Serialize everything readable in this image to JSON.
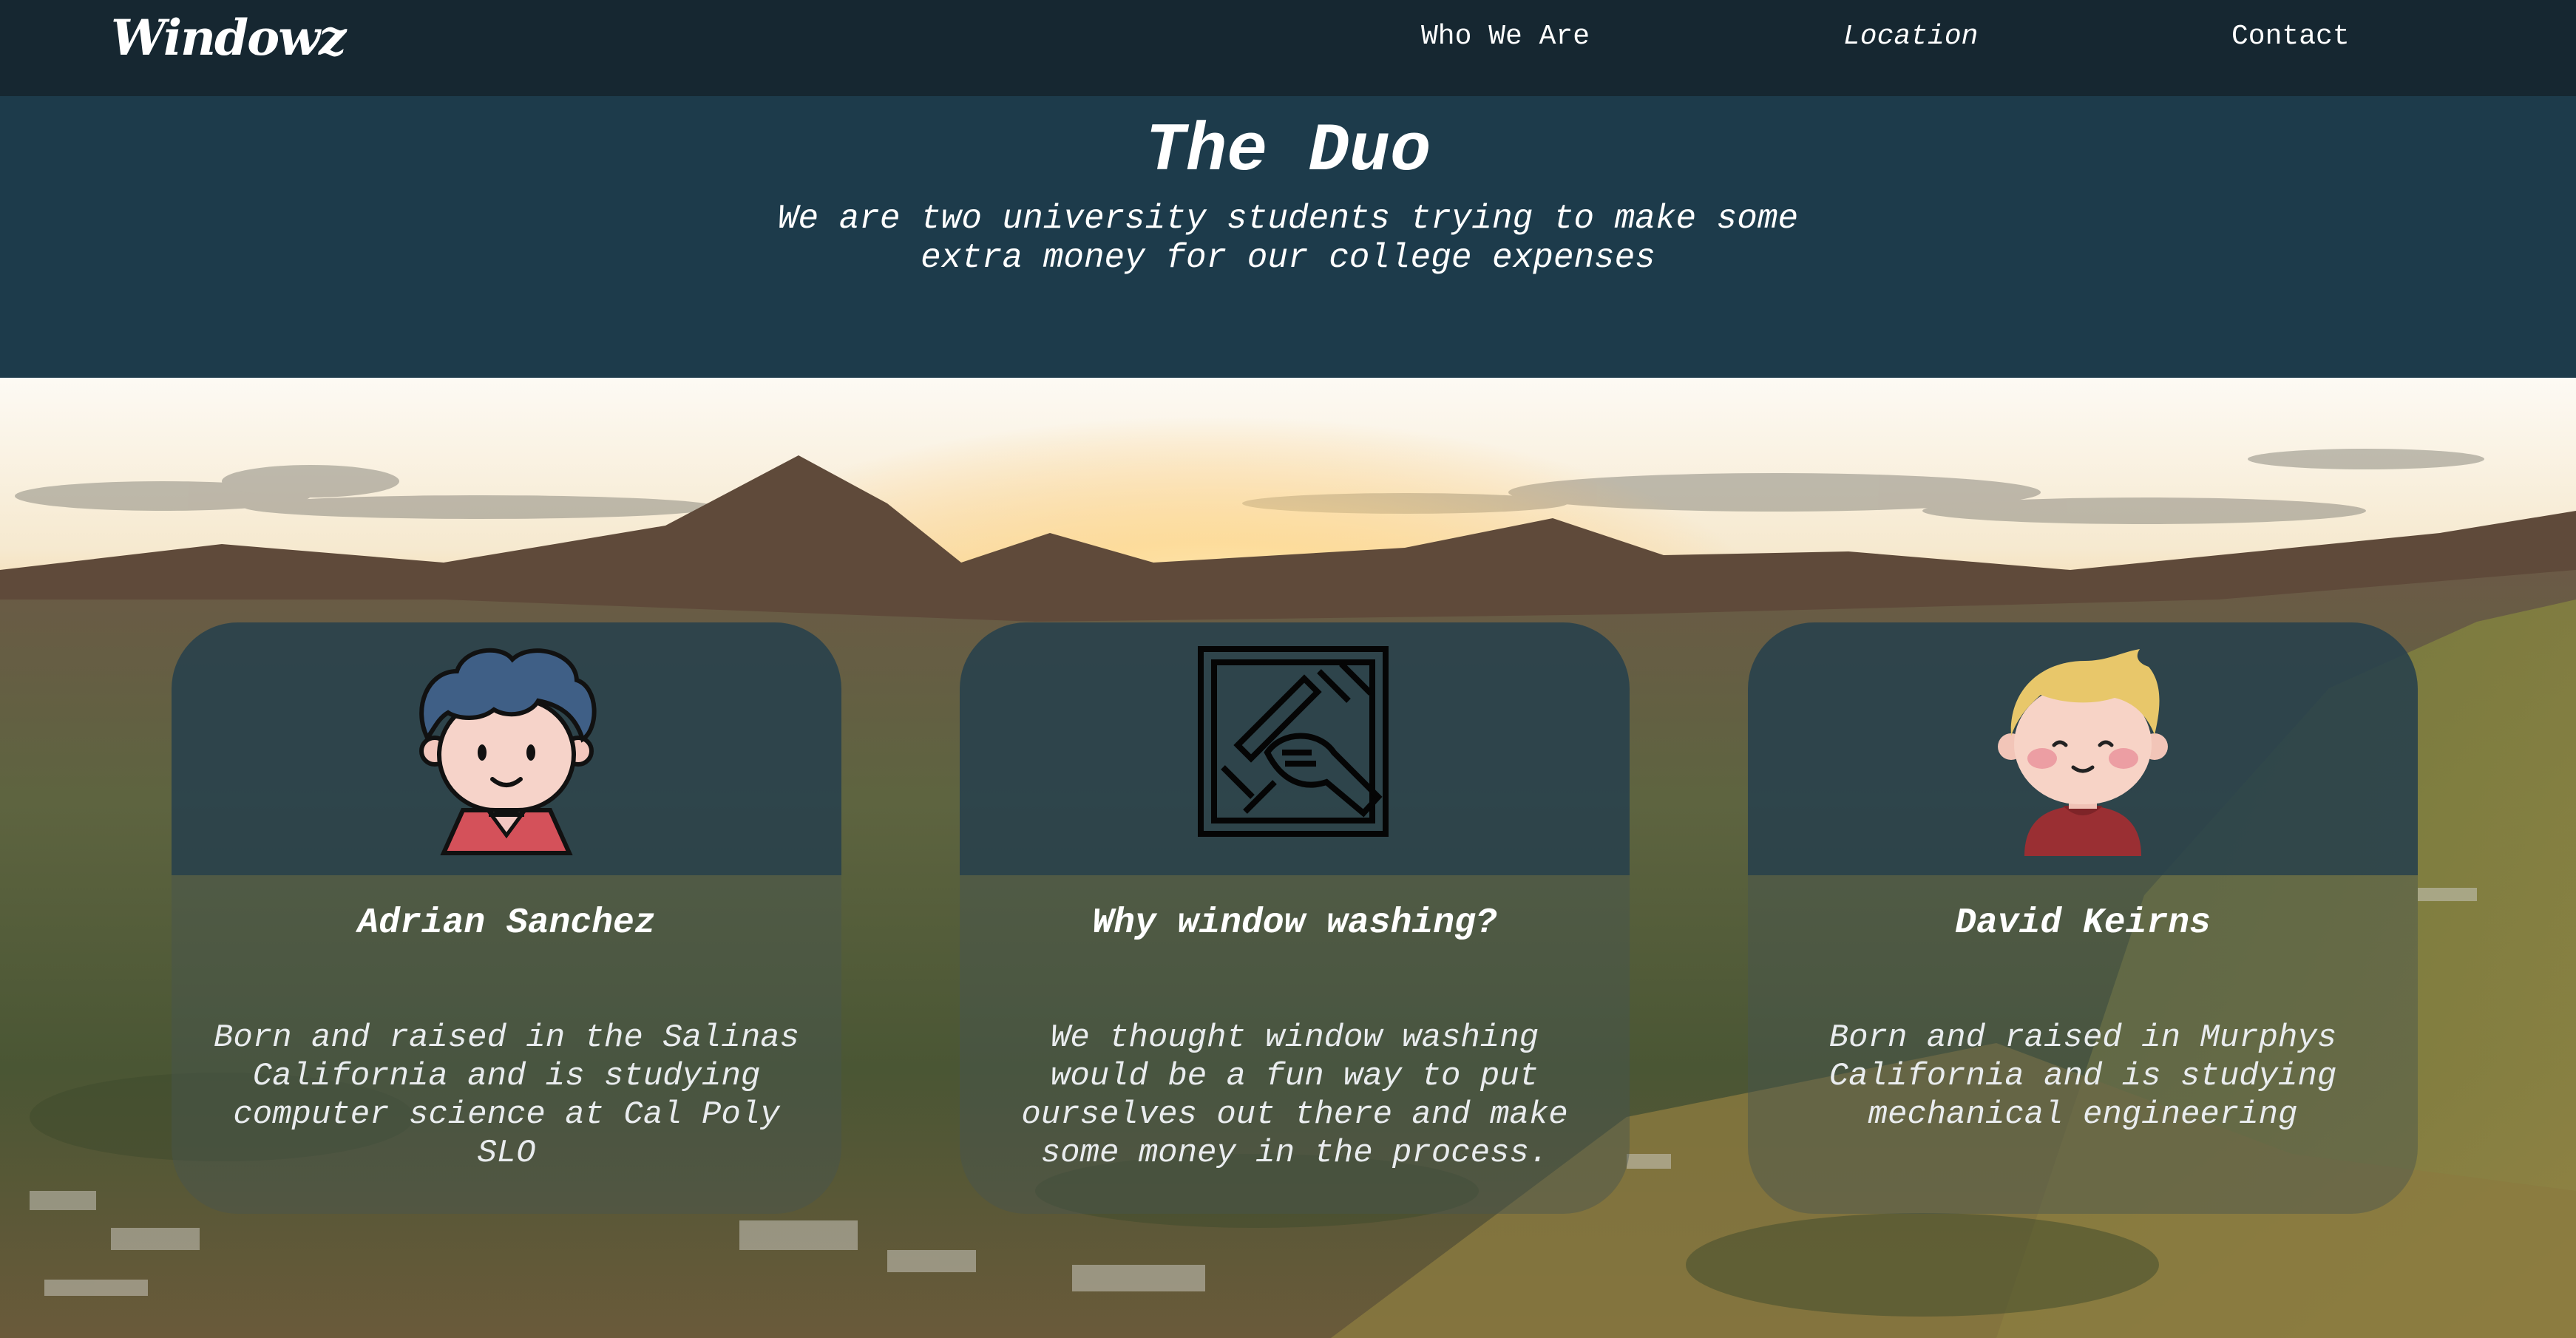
{
  "nav": {
    "logo": "Windowz",
    "links": [
      {
        "label": "Who We Are"
      },
      {
        "label": "Location"
      },
      {
        "label": "Contact"
      }
    ]
  },
  "hero": {
    "title": "The Duo",
    "subtitle": "We are two university students trying to make some extra money for our college expenses"
  },
  "cards": [
    {
      "icon": "boy-avatar-icon",
      "title": "Adrian Sanchez",
      "text": "Born and raised in the Salinas California and is studying computer science at Cal Poly SLO"
    },
    {
      "icon": "window-washing-icon",
      "title": "Why window washing?",
      "text": "We thought window washing would be a fun way to put ourselves out there and make some money in the process."
    },
    {
      "icon": "blond-boy-avatar-icon",
      "title": "David Keirns",
      "text": "Born and raised in Murphys California and is studying mechanical engineering"
    }
  ],
  "colors": {
    "navbar": "#162731",
    "hero": "#1d3b4b",
    "card_top": "#26404c",
    "text": "#ffffff"
  }
}
